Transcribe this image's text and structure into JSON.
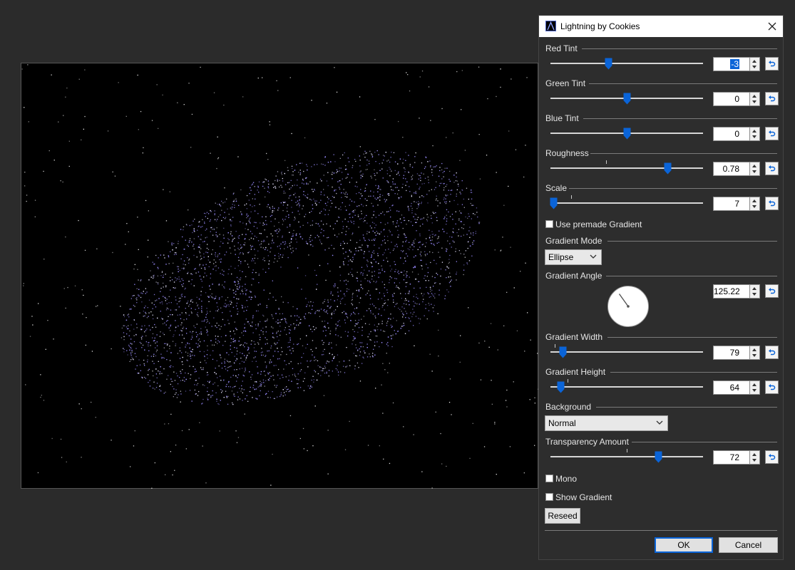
{
  "dialog": {
    "title": "Lightning by Cookies",
    "ok_label": "OK",
    "cancel_label": "Cancel"
  },
  "controls": {
    "red_tint": {
      "label": "Red Tint",
      "value": "-3",
      "slider_fraction": 0.38
    },
    "green_tint": {
      "label": "Green Tint",
      "value": "0",
      "slider_fraction": 0.5
    },
    "blue_tint": {
      "label": "Blue Tint",
      "value": "0",
      "slider_fraction": 0.5
    },
    "roughness": {
      "label": "Roughness",
      "value": "0.78",
      "slider_fraction": 0.77
    },
    "scale": {
      "label": "Scale",
      "value": "7",
      "slider_fraction": 0.02
    },
    "use_premade_gradient": {
      "label": "Use premade Gradient",
      "checked": false
    },
    "gradient_mode": {
      "label": "Gradient Mode",
      "selected": "Ellipse"
    },
    "gradient_angle": {
      "label": "Gradient Angle",
      "value": "125.22"
    },
    "gradient_width": {
      "label": "Gradient Width",
      "value": "79",
      "slider_fraction": 0.08
    },
    "gradient_height": {
      "label": "Gradient Height",
      "value": "64",
      "slider_fraction": 0.07
    },
    "background": {
      "label": "Background",
      "selected": "Normal"
    },
    "transparency_amount": {
      "label": "Transparency Amount",
      "value": "72",
      "slider_fraction": 0.71
    },
    "mono": {
      "label": "Mono",
      "checked": false
    },
    "show_gradient": {
      "label": "Show Gradient",
      "checked": false
    },
    "reseed_label": "Reseed"
  },
  "icons": {
    "app": "lightning-app-icon",
    "close": "close-icon",
    "reset": "reset-arrow-icon",
    "dropdown": "chevron-down-icon"
  },
  "colors": {
    "accent": "#0a64d8",
    "panel": "#2d2d2d",
    "canvas": "#000000",
    "particle": "#9a8cff"
  }
}
